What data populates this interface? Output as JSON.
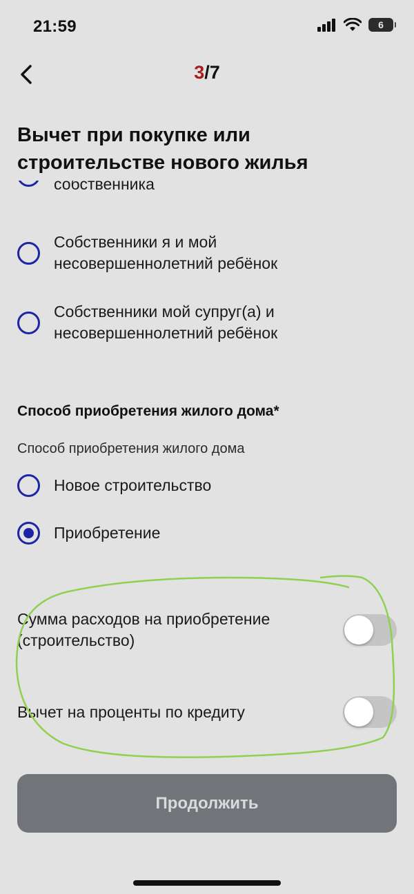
{
  "status_bar": {
    "time": "21:59",
    "battery": "6"
  },
  "nav": {
    "step_current": "3",
    "step_separator": "/",
    "step_total": "7"
  },
  "title": "Вычет при покупке или строительстве нового жилья",
  "owner_options": [
    {
      "label": "собственника",
      "checked": false
    },
    {
      "label": "Собственники я и мой несовершеннолетний ребёнок",
      "checked": false
    },
    {
      "label": "Собственники мой супруг(а) и несовершеннолетний ребёнок",
      "checked": false
    }
  ],
  "acquisition": {
    "heading": "Способ приобретения жилого дома*",
    "sublabel": "Способ приобретения жилого дома",
    "options": [
      {
        "label": "Новое строительство",
        "checked": false
      },
      {
        "label": "Приобретение",
        "checked": true
      }
    ]
  },
  "toggles": [
    {
      "label": "Сумма расходов на приобретение (строительство)",
      "on": false
    },
    {
      "label": "Вычет на проценты по кредиту",
      "on": false
    }
  ],
  "continue_label": "Продолжить",
  "colors": {
    "background": "#e2e2e2",
    "accent_radio": "#1e24a6",
    "step_current": "#a61b1b",
    "button_bg": "#717579",
    "annotation": "#8fd14f"
  }
}
